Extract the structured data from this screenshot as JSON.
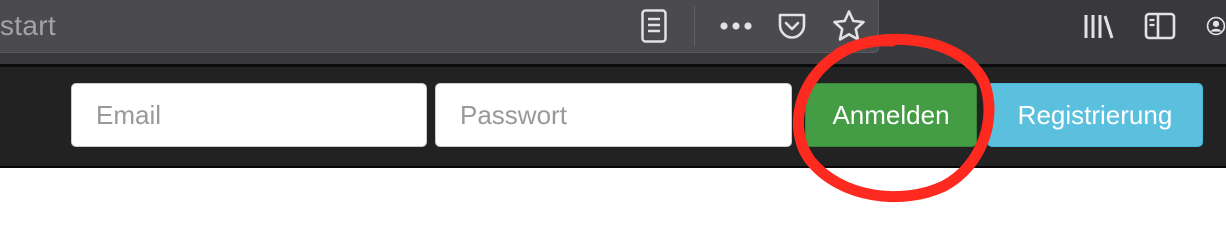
{
  "browser": {
    "url_text": "start",
    "icons": [
      "reader-view-icon",
      "more-icon",
      "pocket-icon",
      "bookmark-star-icon",
      "library-icon",
      "sidebar-icon",
      "account-icon"
    ]
  },
  "header": {
    "email": {
      "placeholder": "Email",
      "value": ""
    },
    "password": {
      "placeholder": "Passwort",
      "value": ""
    },
    "login_label": "Anmelden",
    "register_label": "Registrierung"
  },
  "colors": {
    "login_button": "#449d44",
    "register_button": "#5bc0de",
    "header_background": "#222222",
    "annotation_circle": "#ff2a1f"
  }
}
